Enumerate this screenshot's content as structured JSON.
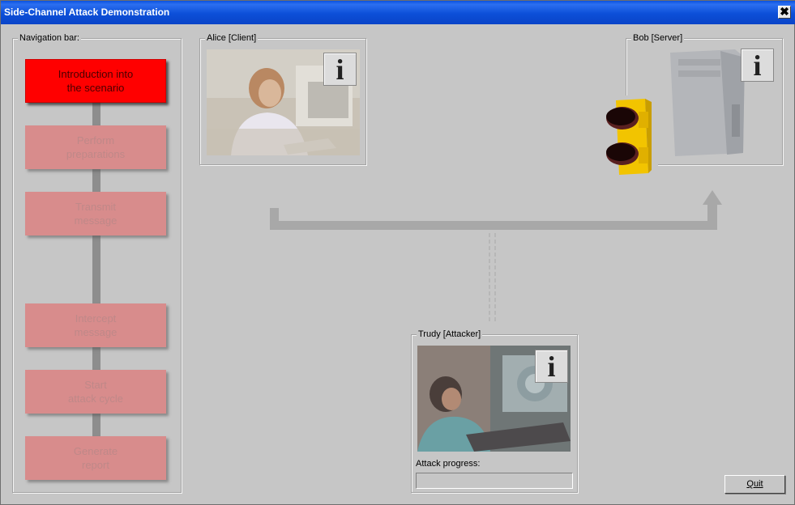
{
  "window": {
    "title": "Side-Channel Attack Demonstration",
    "close_glyph": "✖"
  },
  "navigation": {
    "legend": "Navigation bar:",
    "items": [
      {
        "label": "Introduction into\nthe scenario",
        "active": true
      },
      {
        "label": "Perform\npreparations",
        "active": false
      },
      {
        "label": "Transmit\nmessage",
        "active": false
      },
      {
        "label": "Intercept\nmessage",
        "active": false
      },
      {
        "label": "Start\nattack cycle",
        "active": false
      },
      {
        "label": "Generate\nreport",
        "active": false
      }
    ]
  },
  "alice": {
    "legend": "Alice [Client]",
    "info_glyph": "i"
  },
  "bob": {
    "legend": "Bob [Server]",
    "info_glyph": "i"
  },
  "trudy": {
    "legend": "Trudy [Attacker]",
    "info_glyph": "i",
    "progress_label": "Attack progress:",
    "progress_value": 0
  },
  "quit": {
    "label": "Quit"
  },
  "colors": {
    "active": "#ff0000",
    "inactive": "#d88c8c",
    "titlebar": "#0a4fd8",
    "traffic_light": "#f2c400"
  }
}
